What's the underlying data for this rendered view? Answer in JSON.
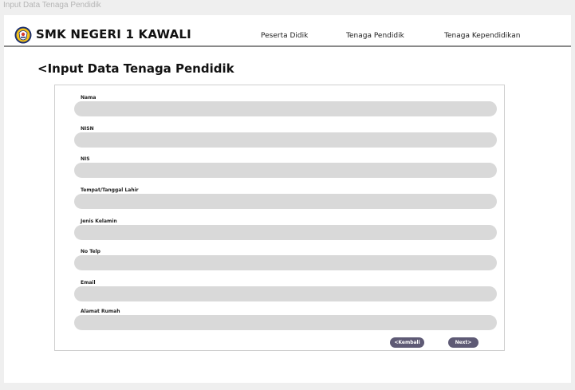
{
  "frame_title": "Input Data Tenaga Pendidik",
  "header": {
    "brand": "SMK NEGERI 1 KAWALI",
    "logo_icon": "school-crest-icon",
    "nav": [
      {
        "label": "Peserta Didik"
      },
      {
        "label": "Tenaga Pendidik"
      },
      {
        "label": "Tenaga Kependidikan"
      }
    ]
  },
  "page_title": "<Input Data Tenaga Pendidik",
  "form": {
    "fields": [
      {
        "label": "Nama",
        "value": "",
        "placeholder": ""
      },
      {
        "label": "NISN",
        "value": "",
        "placeholder": ""
      },
      {
        "label": "NIS",
        "value": "",
        "placeholder": ""
      },
      {
        "label": "Tempat/Tanggal Lahir",
        "value": "",
        "placeholder": ""
      },
      {
        "label": "Jenis Kelamin",
        "value": "",
        "placeholder": ""
      },
      {
        "label": "No Telp",
        "value": "",
        "placeholder": ""
      },
      {
        "label": "Email",
        "value": "",
        "placeholder": ""
      },
      {
        "label": "Alamat Rumah",
        "value": "",
        "placeholder": ""
      }
    ],
    "back_label": "<Kembali",
    "next_label": "Next>"
  },
  "colors": {
    "input_bg": "#d9d9d9",
    "button_bg": "#5e5a75",
    "header_rule": "#8a8a8a"
  }
}
